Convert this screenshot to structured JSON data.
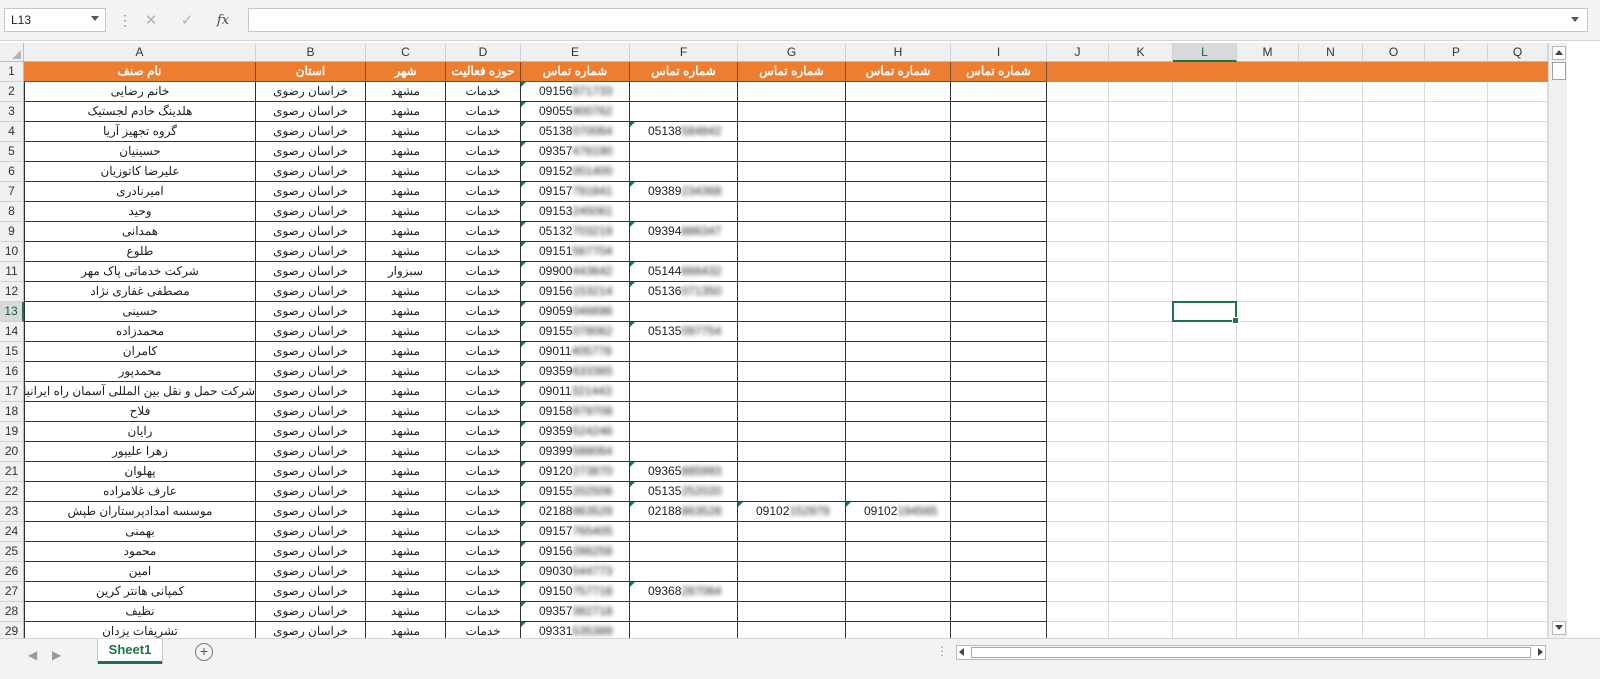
{
  "formula_bar": {
    "name_box": "L13",
    "fx_label": "fx",
    "formula_value": "",
    "cancel_glyph": "✕",
    "enter_glyph": "✓",
    "vdots": "⋮"
  },
  "columns": [
    "A",
    "B",
    "C",
    "D",
    "E",
    "F",
    "G",
    "H",
    "I",
    "J",
    "K",
    "L",
    "M",
    "N",
    "O",
    "P",
    "Q"
  ],
  "selected_cell": "L13",
  "header_row": {
    "A": "نام صنف",
    "B": "استان",
    "C": "شهر",
    "D": "حوزه فعالیت",
    "E": "شماره تماس",
    "F": "شماره تماس",
    "G": "شماره تماس",
    "H": "شماره تماس",
    "I": "شماره تماس"
  },
  "rows": [
    {
      "n": "2",
      "A": "خانم رضایی",
      "B": "خراسان رضوی",
      "C": "مشهد",
      "D": "خدمات",
      "E": "09156871733",
      "F": "",
      "G": "",
      "H": ""
    },
    {
      "n": "3",
      "A": "هلدینگ خادم لجستیک",
      "B": "خراسان رضوی",
      "C": "مشهد",
      "D": "خدمات",
      "E": "09055900762",
      "F": "",
      "G": "",
      "H": ""
    },
    {
      "n": "4",
      "A": "گروه تجهیز آریا",
      "B": "خراسان رضوی",
      "C": "مشهد",
      "D": "خدمات",
      "E": "05138070064",
      "F": "05138584842",
      "G": "",
      "H": ""
    },
    {
      "n": "5",
      "A": "حسینیان",
      "B": "خراسان رضوی",
      "C": "مشهد",
      "D": "خدمات",
      "E": "09357476190",
      "F": "",
      "G": "",
      "H": ""
    },
    {
      "n": "6",
      "A": "علیرضا کاتوزیان",
      "B": "خراسان رضوی",
      "C": "مشهد",
      "D": "خدمات",
      "E": "09152001400",
      "F": "",
      "G": "",
      "H": ""
    },
    {
      "n": "7",
      "A": "امیرنادری",
      "B": "خراسان رضوی",
      "C": "مشهد",
      "D": "خدمات",
      "E": "09157791841",
      "F": "09389234368",
      "G": "",
      "H": ""
    },
    {
      "n": "8",
      "A": "وحید",
      "B": "خراسان رضوی",
      "C": "مشهد",
      "D": "خدمات",
      "E": "09153245061",
      "F": "",
      "G": "",
      "H": ""
    },
    {
      "n": "9",
      "A": "همدانی",
      "B": "خراسان رضوی",
      "C": "مشهد",
      "D": "خدمات",
      "E": "05132703219",
      "F": "09394886347",
      "G": "",
      "H": ""
    },
    {
      "n": "10",
      "A": "طلوع",
      "B": "خراسان رضوی",
      "C": "مشهد",
      "D": "خدمات",
      "E": "09151567704",
      "F": "",
      "G": "",
      "H": ""
    },
    {
      "n": "11",
      "A": "شرکت خدماتی پاک مهر",
      "B": "خراسان رضوی",
      "C": "سبزوار",
      "D": "خدمات",
      "E": "09900443642",
      "F": "05144666432",
      "G": "",
      "H": ""
    },
    {
      "n": "12",
      "A": "مصطفی غفاری نژاد",
      "B": "خراسان رضوی",
      "C": "مشهد",
      "D": "خدمات",
      "E": "09156153214",
      "F": "05136071350",
      "G": "",
      "H": ""
    },
    {
      "n": "13",
      "A": "حسینی",
      "B": "خراسان رضوی",
      "C": "مشهد",
      "D": "خدمات",
      "E": "09059046696",
      "F": "",
      "G": "",
      "H": ""
    },
    {
      "n": "14",
      "A": "محمدزاده",
      "B": "خراسان رضوی",
      "C": "مشهد",
      "D": "خدمات",
      "E": "09155078062",
      "F": "05135097754",
      "G": "",
      "H": ""
    },
    {
      "n": "15",
      "A": "کامران",
      "B": "خراسان رضوی",
      "C": "مشهد",
      "D": "خدمات",
      "E": "09011405778",
      "F": "",
      "G": "",
      "H": ""
    },
    {
      "n": "16",
      "A": "محمدپور",
      "B": "خراسان رضوی",
      "C": "مشهد",
      "D": "خدمات",
      "E": "09359633365",
      "F": "",
      "G": "",
      "H": ""
    },
    {
      "n": "17",
      "A": "شرکت حمل و نقل بین المللی آسمان راه ایرانیان",
      "B": "خراسان رضوی",
      "C": "مشهد",
      "D": "خدمات",
      "E": "09011321443",
      "F": "",
      "G": "",
      "H": ""
    },
    {
      "n": "18",
      "A": "فلاح",
      "B": "خراسان رضوی",
      "C": "مشهد",
      "D": "خدمات",
      "E": "09158979708",
      "F": "",
      "G": "",
      "H": ""
    },
    {
      "n": "19",
      "A": "رایان",
      "B": "خراسان رضوی",
      "C": "مشهد",
      "D": "خدمات",
      "E": "09359524246",
      "F": "",
      "G": "",
      "H": ""
    },
    {
      "n": "20",
      "A": "زهرا علیپور",
      "B": "خراسان رضوی",
      "C": "مشهد",
      "D": "خدمات",
      "E": "09399588064",
      "F": "",
      "G": "",
      "H": ""
    },
    {
      "n": "21",
      "A": "پهلوان",
      "B": "خراسان رضوی",
      "C": "مشهد",
      "D": "خدمات",
      "E": "09120273870",
      "F": "09365885993",
      "G": "",
      "H": ""
    },
    {
      "n": "22",
      "A": "عارف غلامزاده",
      "B": "خراسان رضوی",
      "C": "مشهد",
      "D": "خدمات",
      "E": "09155202506",
      "F": "05135252020",
      "G": "",
      "H": ""
    },
    {
      "n": "23",
      "A": "موسسه امدادپرستاران طپش",
      "B": "خراسان رضوی",
      "C": "مشهد",
      "D": "خدمات",
      "E": "02188863529",
      "F": "02188863528",
      "G": "09102152979",
      "H": "09102194565"
    },
    {
      "n": "24",
      "A": "بهمنی",
      "B": "خراسان رضوی",
      "C": "مشهد",
      "D": "خدمات",
      "E": "09157765405",
      "F": "",
      "G": "",
      "H": ""
    },
    {
      "n": "25",
      "A": "محمود",
      "B": "خراسان رضوی",
      "C": "مشهد",
      "D": "خدمات",
      "E": "09156286258",
      "F": "",
      "G": "",
      "H": ""
    },
    {
      "n": "26",
      "A": "امین",
      "B": "خراسان رضوی",
      "C": "مشهد",
      "D": "خدمات",
      "E": "09030544773",
      "F": "",
      "G": "",
      "H": ""
    },
    {
      "n": "27",
      "A": "کمپانی هانتر کرین",
      "B": "خراسان رضوی",
      "C": "مشهد",
      "D": "خدمات",
      "E": "09150757718",
      "F": "09368287064",
      "G": "",
      "H": ""
    },
    {
      "n": "28",
      "A": "نظیف",
      "B": "خراسان رضوی",
      "C": "مشهد",
      "D": "خدمات",
      "E": "09357382718",
      "F": "",
      "G": "",
      "H": ""
    },
    {
      "n": "29",
      "A": "تشریفات یزدان",
      "B": "خراسان رضوی",
      "C": "مشهد",
      "D": "خدمات",
      "E": "09331535389",
      "F": "",
      "G": "",
      "H": ""
    }
  ],
  "sheet_bar": {
    "active_sheet": "Sheet1",
    "add_sheet_glyph": "+",
    "prev_glyph": "◀",
    "next_glyph": "▶",
    "dots": "⋮"
  },
  "colors": {
    "header_fill": "#ed7d31",
    "excel_green": "#217346"
  }
}
